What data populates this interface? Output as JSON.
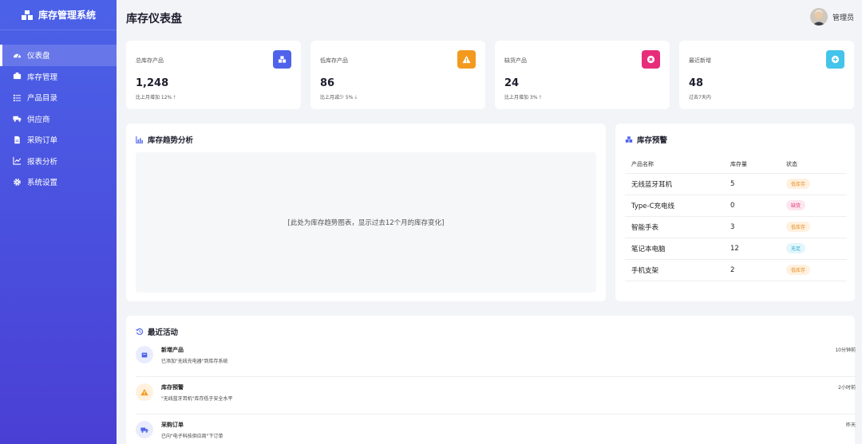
{
  "app": {
    "name": "库存管理系统"
  },
  "sidebar": {
    "items": [
      {
        "label": "仪表盘",
        "icon": "dashboard-icon",
        "active": true
      },
      {
        "label": "库存管理",
        "icon": "boxes-icon"
      },
      {
        "label": "产品目录",
        "icon": "list-icon"
      },
      {
        "label": "供应商",
        "icon": "truck-icon"
      },
      {
        "label": "采购订单",
        "icon": "document-icon"
      },
      {
        "label": "报表分析",
        "icon": "line-chart-icon"
      },
      {
        "label": "系统设置",
        "icon": "gear-icon"
      }
    ]
  },
  "header": {
    "title": "库存仪表盘",
    "user_name": "管理员"
  },
  "stats": [
    {
      "label": "总库存产品",
      "value": "1,248",
      "sub": "比上月增加 12%",
      "trend": "up",
      "icon": "boxes-icon",
      "color": "#4f63ea"
    },
    {
      "label": "低库存产品",
      "value": "86",
      "sub": "比上月减少 5%",
      "trend": "down",
      "icon": "warning-icon",
      "color": "#f39a1e"
    },
    {
      "label": "缺货产品",
      "value": "24",
      "sub": "比上月增加 3%",
      "trend": "up",
      "icon": "x-circle-icon",
      "color": "#e72d79"
    },
    {
      "label": "最近新增",
      "value": "48",
      "sub": "过去7天内",
      "trend": "",
      "icon": "plus-circle-icon",
      "color": "#43c4ea"
    }
  ],
  "trend_panel": {
    "title": "库存趋势分析",
    "placeholder": "[此处为库存趋势图表，显示过去12个月的库存变化]"
  },
  "alerts_panel": {
    "title": "库存预警",
    "columns": [
      "产品名称",
      "库存量",
      "状态"
    ],
    "rows": [
      {
        "name": "无线蓝牙耳机",
        "qty": "5",
        "status": "低库存",
        "kind": "low"
      },
      {
        "name": "Type-C充电线",
        "qty": "0",
        "status": "缺货",
        "kind": "out"
      },
      {
        "name": "智能手表",
        "qty": "3",
        "status": "低库存",
        "kind": "low"
      },
      {
        "name": "笔记本电脑",
        "qty": "12",
        "status": "充足",
        "kind": "ok"
      },
      {
        "name": "手机支架",
        "qty": "2",
        "status": "低库存",
        "kind": "low"
      }
    ]
  },
  "activity_panel": {
    "title": "最近活动",
    "items": [
      {
        "title": "新增产品",
        "desc": "已添加\"无线充电器\"到库存系统",
        "time": "10分钟前",
        "icon": "box-icon",
        "color": "#4f63ea",
        "bg": "#e9ecfd"
      },
      {
        "title": "库存预警",
        "desc": "\"无线蓝牙耳机\"库存低于安全水平",
        "time": "2小时前",
        "icon": "warning-icon",
        "color": "#f39a1e",
        "bg": "#fff1de"
      },
      {
        "title": "采购订单",
        "desc": "已向\"电子科技供应商\"下订单",
        "time": "昨天",
        "icon": "truck-icon",
        "color": "#4f63ea",
        "bg": "#e9ecfd"
      }
    ]
  }
}
